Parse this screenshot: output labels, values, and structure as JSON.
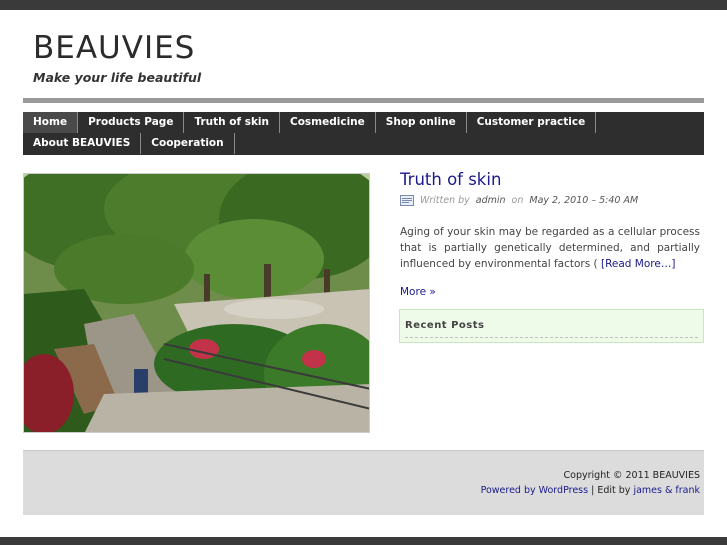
{
  "site": {
    "title": "BEAUVIES",
    "tagline": "Make your life beautiful"
  },
  "nav": {
    "items": [
      {
        "label": "Home",
        "active": true
      },
      {
        "label": "Products Page"
      },
      {
        "label": "Truth of skin"
      },
      {
        "label": "Cosmedicine"
      },
      {
        "label": "Shop online"
      },
      {
        "label": "Customer practice"
      },
      {
        "label": "About BEAUVIES"
      },
      {
        "label": "Cooperation"
      }
    ]
  },
  "post": {
    "title": "Truth of skin",
    "written_by": "Written by",
    "author": "admin",
    "on": "on",
    "date": "May 2, 2010 – 5:40 AM",
    "excerpt": "Aging of your skin may be regarded as a cellular process that is partially genetically determined, and partially influenced by environmental factors (",
    "read_more": "[Read More…]",
    "more": "More »"
  },
  "sidebar": {
    "recent_posts_title": "Recent Posts"
  },
  "footer": {
    "copyright": "Copyright © 2011 BEAUVIES",
    "powered_by": "Powered by WordPress",
    "separator": " | Edit by ",
    "editor": "james & frank"
  },
  "colors": {
    "link": "#1a1a8c",
    "nav_bg": "#2e2e2e",
    "recent_bg": "#eefbe9"
  }
}
